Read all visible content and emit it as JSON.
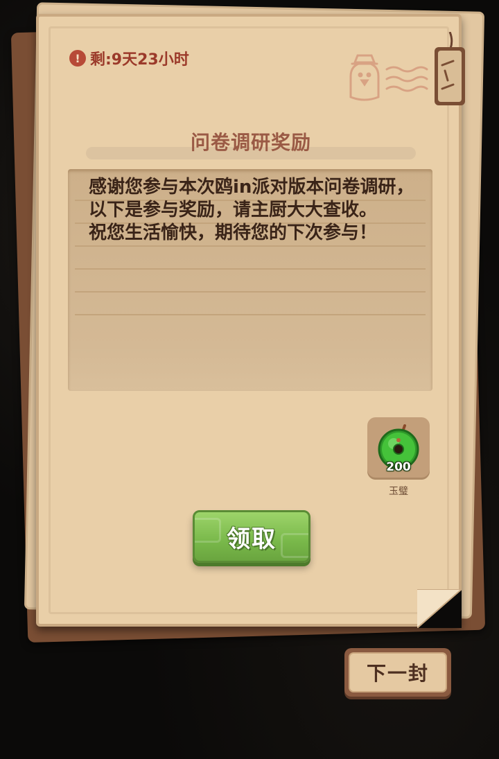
{
  "mail": {
    "timer_icon": "exclamation-icon",
    "timer_text": "剩:9天23小时",
    "title": "问卷调研奖励",
    "message": "感谢您参与本次鸥in派对版本问卷调研，以下是参与奖励，请主厨大大查收。\n祝您生活愉快，期待您的下次参与！",
    "reward": {
      "icon": "jade-disc-icon",
      "count": "200",
      "name": "玉璧"
    },
    "claim_label": "领取"
  },
  "next_label": "下一封",
  "colors": {
    "paper": "#e9cfa8",
    "paper_border": "#c9a982",
    "title": "#9a5a45",
    "timer": "#9b3a2a",
    "claim_green": "#79b84a",
    "next_brown": "#8a5a40"
  }
}
